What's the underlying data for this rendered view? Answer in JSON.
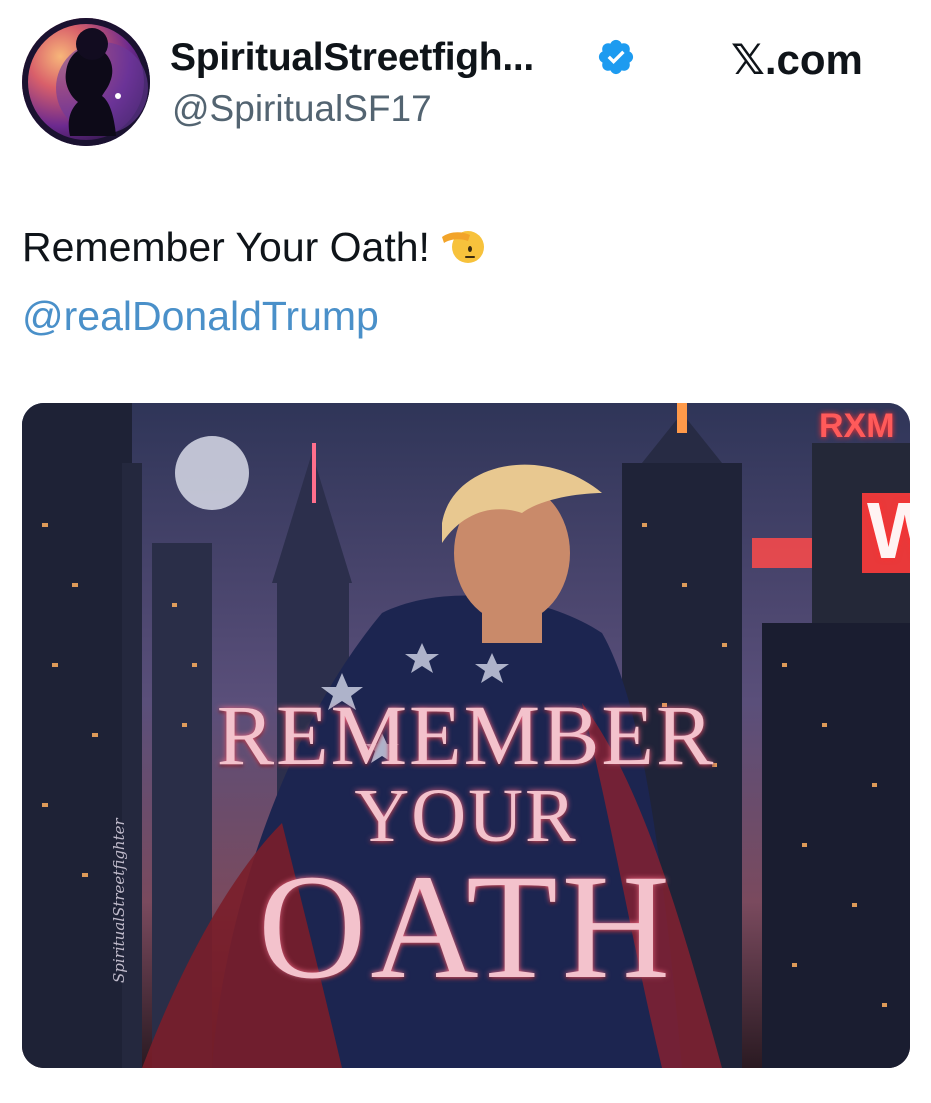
{
  "author": {
    "display_name": "SpiritualStreetfigh...",
    "handle": "@SpiritualSF17",
    "verified": true,
    "avatar_icon": "silhouette-woman-avatar"
  },
  "site": {
    "logo_letter": "𝕏",
    "name": ".com"
  },
  "tweet": {
    "text": "Remember Your Oath!",
    "emoji": "saluting-face",
    "mention": "@realDonaldTrump"
  },
  "media": {
    "title_line1": "REMEMBER",
    "title_line2": "YOUR",
    "title_line3": "OATH",
    "watermark": "SpiritualStreetfighter",
    "sign_text_1": "RXM",
    "sign_text_2": "W"
  },
  "colors": {
    "link": "#4a90c9",
    "verified_badge": "#1d9bf0",
    "secondary_text": "#536471"
  }
}
